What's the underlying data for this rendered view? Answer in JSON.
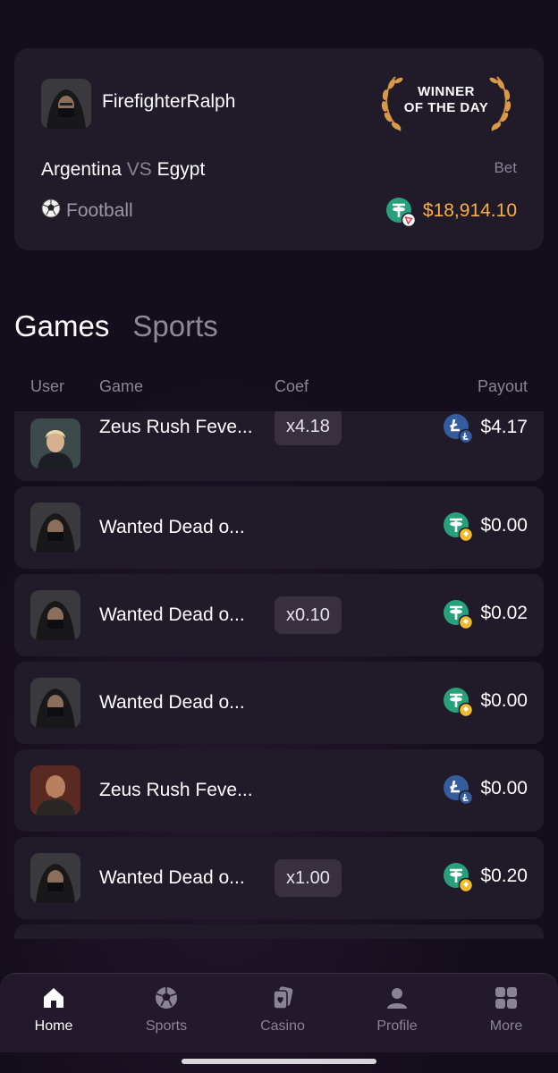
{
  "winner": {
    "username": "FirefighterRalph",
    "badge_line1": "WINNER",
    "badge_line2": "OF THE DAY",
    "team_home": "Argentina",
    "vs": "VS",
    "team_away": "Egypt",
    "bet_label": "Bet",
    "sport_icon": "soccer-ball-icon",
    "sport": "Football",
    "bet_currency_icon": "tether-tron-icon",
    "bet_amount": "$18,914.10",
    "bet_color": "#f5b04a"
  },
  "tabs": {
    "games": "Games",
    "sports": "Sports",
    "active": "games"
  },
  "table": {
    "headers": {
      "user": "User",
      "game": "Game",
      "coef": "Coef",
      "payout": "Payout"
    },
    "rows": [
      {
        "avatar": "blonde-man-avatar",
        "game": "Zeus Rush Feve...",
        "coef": "x4.18",
        "coin": "litecoin",
        "payout": "$4.17"
      },
      {
        "avatar": "hooded-ninja-avatar",
        "game": "Wanted Dead o...",
        "coef": "",
        "coin": "tether-bnb",
        "payout": "$0.00"
      },
      {
        "avatar": "hooded-ninja-avatar",
        "game": "Wanted Dead o...",
        "coef": "x0.10",
        "coin": "tether-bnb",
        "payout": "$0.02"
      },
      {
        "avatar": "hooded-ninja-avatar",
        "game": "Wanted Dead o...",
        "coef": "",
        "coin": "tether-bnb",
        "payout": "$0.00"
      },
      {
        "avatar": "bald-man-avatar",
        "game": "Zeus Rush Feve...",
        "coef": "",
        "coin": "litecoin",
        "payout": "$0.00"
      },
      {
        "avatar": "hooded-ninja-avatar",
        "game": "Wanted Dead o...",
        "coef": "x1.00",
        "coin": "tether-bnb",
        "payout": "$0.20"
      }
    ]
  },
  "nav": [
    {
      "icon": "home-icon",
      "label": "Home",
      "active": true
    },
    {
      "icon": "soccer-ball-icon",
      "label": "Sports",
      "active": false
    },
    {
      "icon": "cards-icon",
      "label": "Casino",
      "active": false
    },
    {
      "icon": "person-icon",
      "label": "Profile",
      "active": false
    },
    {
      "icon": "grid-icon",
      "label": "More",
      "active": false
    }
  ],
  "colors": {
    "background": "#140d1b",
    "card": "#211a29",
    "accent_gold": "#f5b04a",
    "tether": "#26a17b",
    "litecoin": "#345d9d",
    "bnb": "#f3ba2f"
  }
}
